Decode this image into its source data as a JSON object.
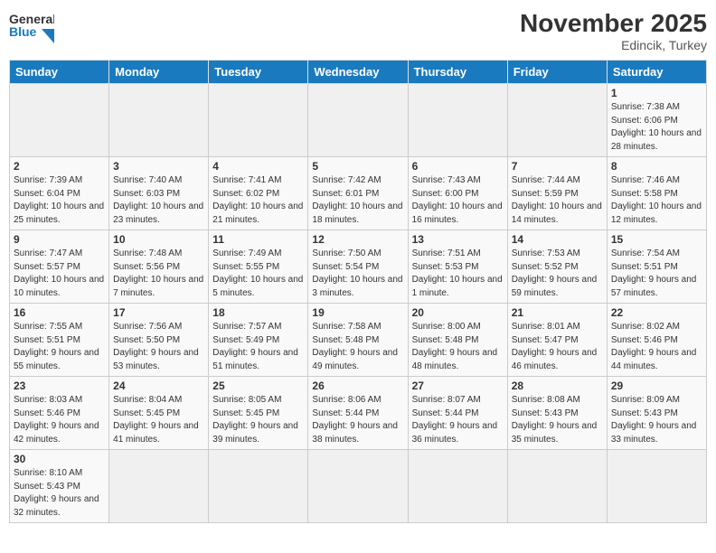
{
  "header": {
    "logo_general": "General",
    "logo_blue": "Blue",
    "month": "November 2025",
    "location": "Edincik, Turkey"
  },
  "days_of_week": [
    "Sunday",
    "Monday",
    "Tuesday",
    "Wednesday",
    "Thursday",
    "Friday",
    "Saturday"
  ],
  "weeks": [
    [
      {
        "day": "",
        "empty": true
      },
      {
        "day": "",
        "empty": true
      },
      {
        "day": "",
        "empty": true
      },
      {
        "day": "",
        "empty": true
      },
      {
        "day": "",
        "empty": true
      },
      {
        "day": "",
        "empty": true
      },
      {
        "day": "1",
        "sunrise": "Sunrise: 7:38 AM",
        "sunset": "Sunset: 6:06 PM",
        "daylight": "Daylight: 10 hours and 28 minutes."
      }
    ],
    [
      {
        "day": "2",
        "sunrise": "Sunrise: 7:39 AM",
        "sunset": "Sunset: 6:04 PM",
        "daylight": "Daylight: 10 hours and 25 minutes."
      },
      {
        "day": "3",
        "sunrise": "Sunrise: 7:40 AM",
        "sunset": "Sunset: 6:03 PM",
        "daylight": "Daylight: 10 hours and 23 minutes."
      },
      {
        "day": "4",
        "sunrise": "Sunrise: 7:41 AM",
        "sunset": "Sunset: 6:02 PM",
        "daylight": "Daylight: 10 hours and 21 minutes."
      },
      {
        "day": "5",
        "sunrise": "Sunrise: 7:42 AM",
        "sunset": "Sunset: 6:01 PM",
        "daylight": "Daylight: 10 hours and 18 minutes."
      },
      {
        "day": "6",
        "sunrise": "Sunrise: 7:43 AM",
        "sunset": "Sunset: 6:00 PM",
        "daylight": "Daylight: 10 hours and 16 minutes."
      },
      {
        "day": "7",
        "sunrise": "Sunrise: 7:44 AM",
        "sunset": "Sunset: 5:59 PM",
        "daylight": "Daylight: 10 hours and 14 minutes."
      },
      {
        "day": "8",
        "sunrise": "Sunrise: 7:46 AM",
        "sunset": "Sunset: 5:58 PM",
        "daylight": "Daylight: 10 hours and 12 minutes."
      }
    ],
    [
      {
        "day": "9",
        "sunrise": "Sunrise: 7:47 AM",
        "sunset": "Sunset: 5:57 PM",
        "daylight": "Daylight: 10 hours and 10 minutes."
      },
      {
        "day": "10",
        "sunrise": "Sunrise: 7:48 AM",
        "sunset": "Sunset: 5:56 PM",
        "daylight": "Daylight: 10 hours and 7 minutes."
      },
      {
        "day": "11",
        "sunrise": "Sunrise: 7:49 AM",
        "sunset": "Sunset: 5:55 PM",
        "daylight": "Daylight: 10 hours and 5 minutes."
      },
      {
        "day": "12",
        "sunrise": "Sunrise: 7:50 AM",
        "sunset": "Sunset: 5:54 PM",
        "daylight": "Daylight: 10 hours and 3 minutes."
      },
      {
        "day": "13",
        "sunrise": "Sunrise: 7:51 AM",
        "sunset": "Sunset: 5:53 PM",
        "daylight": "Daylight: 10 hours and 1 minute."
      },
      {
        "day": "14",
        "sunrise": "Sunrise: 7:53 AM",
        "sunset": "Sunset: 5:52 PM",
        "daylight": "Daylight: 9 hours and 59 minutes."
      },
      {
        "day": "15",
        "sunrise": "Sunrise: 7:54 AM",
        "sunset": "Sunset: 5:51 PM",
        "daylight": "Daylight: 9 hours and 57 minutes."
      }
    ],
    [
      {
        "day": "16",
        "sunrise": "Sunrise: 7:55 AM",
        "sunset": "Sunset: 5:51 PM",
        "daylight": "Daylight: 9 hours and 55 minutes."
      },
      {
        "day": "17",
        "sunrise": "Sunrise: 7:56 AM",
        "sunset": "Sunset: 5:50 PM",
        "daylight": "Daylight: 9 hours and 53 minutes."
      },
      {
        "day": "18",
        "sunrise": "Sunrise: 7:57 AM",
        "sunset": "Sunset: 5:49 PM",
        "daylight": "Daylight: 9 hours and 51 minutes."
      },
      {
        "day": "19",
        "sunrise": "Sunrise: 7:58 AM",
        "sunset": "Sunset: 5:48 PM",
        "daylight": "Daylight: 9 hours and 49 minutes."
      },
      {
        "day": "20",
        "sunrise": "Sunrise: 8:00 AM",
        "sunset": "Sunset: 5:48 PM",
        "daylight": "Daylight: 9 hours and 48 minutes."
      },
      {
        "day": "21",
        "sunrise": "Sunrise: 8:01 AM",
        "sunset": "Sunset: 5:47 PM",
        "daylight": "Daylight: 9 hours and 46 minutes."
      },
      {
        "day": "22",
        "sunrise": "Sunrise: 8:02 AM",
        "sunset": "Sunset: 5:46 PM",
        "daylight": "Daylight: 9 hours and 44 minutes."
      }
    ],
    [
      {
        "day": "23",
        "sunrise": "Sunrise: 8:03 AM",
        "sunset": "Sunset: 5:46 PM",
        "daylight": "Daylight: 9 hours and 42 minutes."
      },
      {
        "day": "24",
        "sunrise": "Sunrise: 8:04 AM",
        "sunset": "Sunset: 5:45 PM",
        "daylight": "Daylight: 9 hours and 41 minutes."
      },
      {
        "day": "25",
        "sunrise": "Sunrise: 8:05 AM",
        "sunset": "Sunset: 5:45 PM",
        "daylight": "Daylight: 9 hours and 39 minutes."
      },
      {
        "day": "26",
        "sunrise": "Sunrise: 8:06 AM",
        "sunset": "Sunset: 5:44 PM",
        "daylight": "Daylight: 9 hours and 38 minutes."
      },
      {
        "day": "27",
        "sunrise": "Sunrise: 8:07 AM",
        "sunset": "Sunset: 5:44 PM",
        "daylight": "Daylight: 9 hours and 36 minutes."
      },
      {
        "day": "28",
        "sunrise": "Sunrise: 8:08 AM",
        "sunset": "Sunset: 5:43 PM",
        "daylight": "Daylight: 9 hours and 35 minutes."
      },
      {
        "day": "29",
        "sunrise": "Sunrise: 8:09 AM",
        "sunset": "Sunset: 5:43 PM",
        "daylight": "Daylight: 9 hours and 33 minutes."
      }
    ],
    [
      {
        "day": "30",
        "sunrise": "Sunrise: 8:10 AM",
        "sunset": "Sunset: 5:43 PM",
        "daylight": "Daylight: 9 hours and 32 minutes."
      },
      {
        "day": "",
        "empty": true
      },
      {
        "day": "",
        "empty": true
      },
      {
        "day": "",
        "empty": true
      },
      {
        "day": "",
        "empty": true
      },
      {
        "day": "",
        "empty": true
      },
      {
        "day": "",
        "empty": true
      }
    ]
  ]
}
